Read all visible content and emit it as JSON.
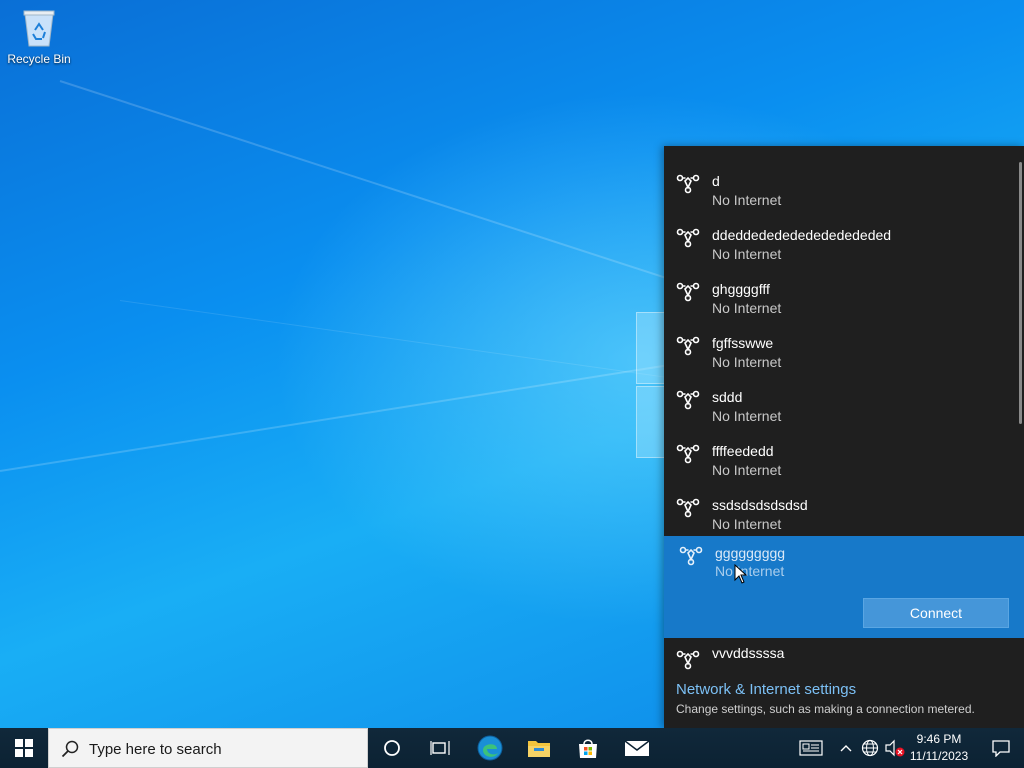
{
  "desktop": {
    "recycle_bin_label": "Recycle Bin"
  },
  "flyout": {
    "networks": [
      {
        "ssid": "d",
        "status": "No Internet"
      },
      {
        "ssid": "ddeddededededededededed",
        "status": "No Internet"
      },
      {
        "ssid": "ghggggfff",
        "status": "No Internet"
      },
      {
        "ssid": "fgffsswwe",
        "status": "No Internet"
      },
      {
        "ssid": "sddd",
        "status": "No Internet"
      },
      {
        "ssid": "ffffeededd",
        "status": "No Internet"
      },
      {
        "ssid": "ssdsdsdsdsdsd",
        "status": "No Internet"
      }
    ],
    "selected": {
      "ssid": "ggggggggg",
      "status": "No Internet",
      "connect_label": "Connect"
    },
    "after": [
      {
        "ssid": "vvvddssssa"
      }
    ],
    "settings_link": "Network & Internet settings",
    "settings_desc": "Change settings, such as making a connection metered."
  },
  "taskbar": {
    "search_placeholder": "Type here to search",
    "apps": [
      "cortana-icon",
      "task-view-icon",
      "edge-icon",
      "file-explorer-icon",
      "store-icon",
      "mail-icon"
    ],
    "tray": [
      "news-icon",
      "chevron-up-icon",
      "network-globe-icon",
      "volume-muted-icon"
    ],
    "time": "9:46 PM",
    "date": "11/11/2023"
  },
  "colors": {
    "flyout_bg": "#1f1f1f",
    "selected_bg": "#1779c9",
    "connect_bg": "#4596d9",
    "link": "#7cc0f5",
    "taskbar_bg": "#10283a"
  }
}
